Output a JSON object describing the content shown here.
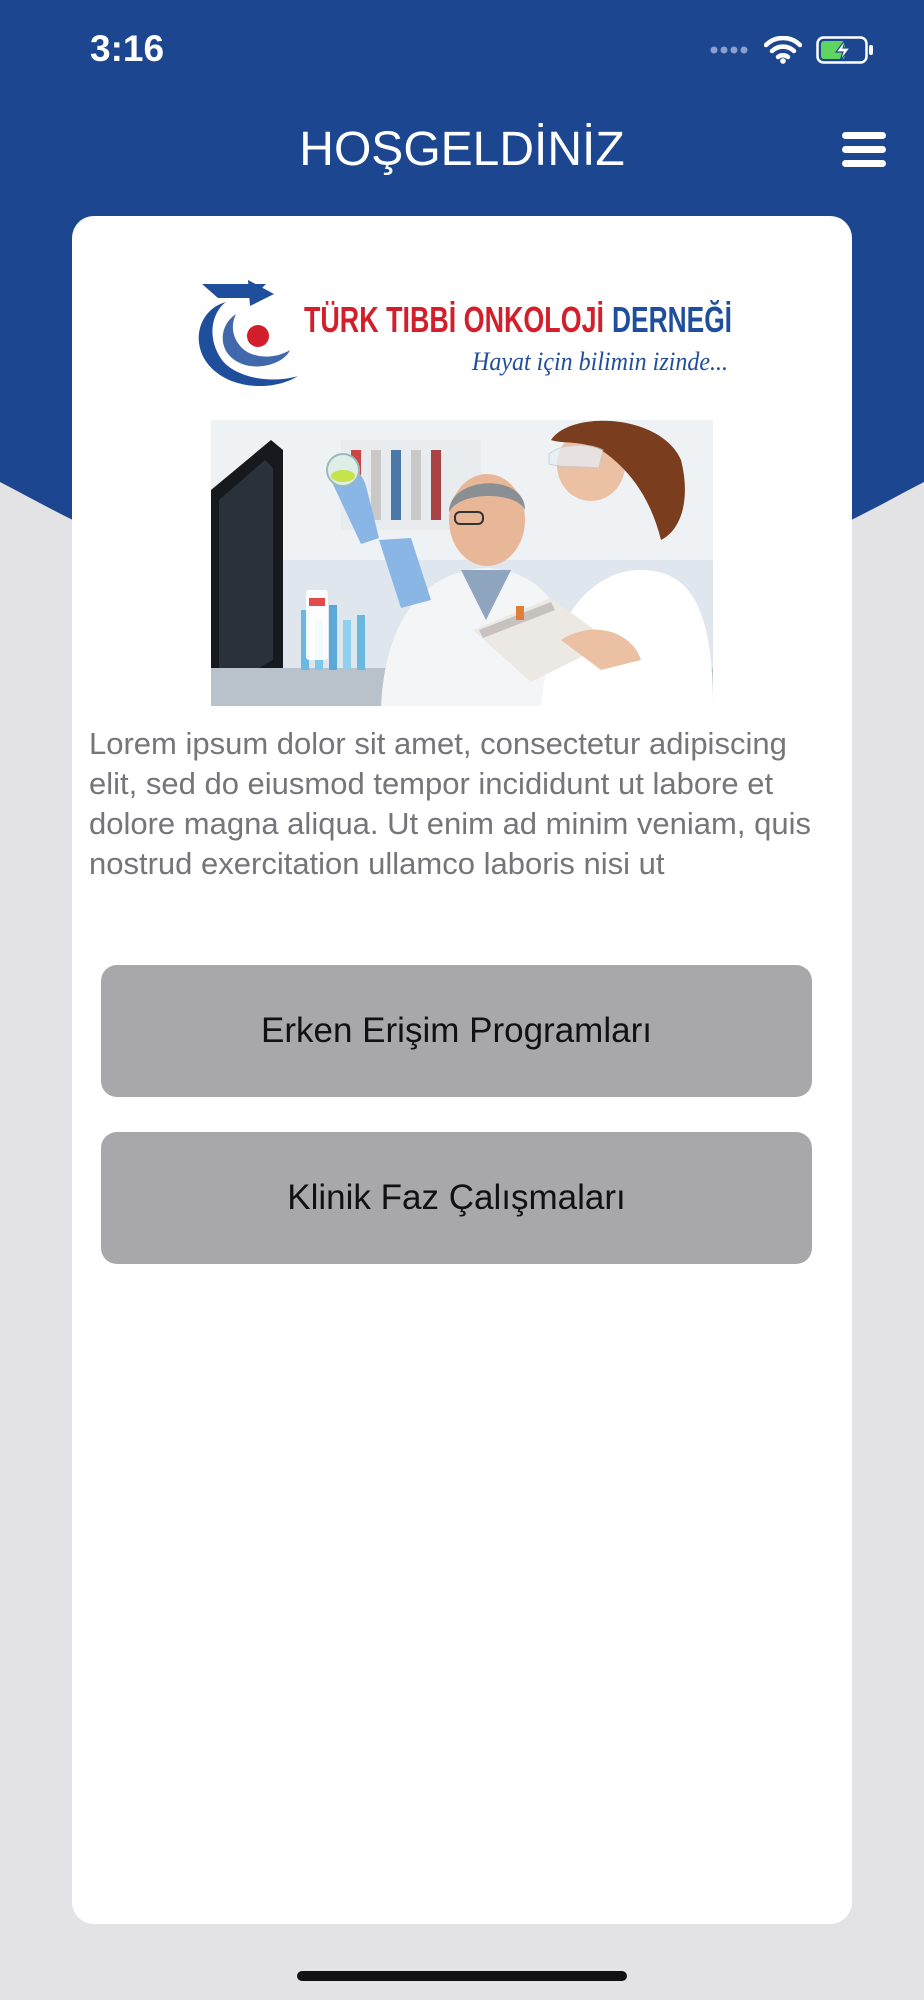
{
  "status_bar": {
    "time": "3:16",
    "icons": [
      "signal-dots-icon",
      "wifi-icon",
      "battery-charging-icon"
    ]
  },
  "header": {
    "title": "HOŞGELDİNİZ",
    "menu_icon": "hamburger-menu-icon"
  },
  "logo": {
    "name": "TÜRK TIBBİ ONKOLOJİ DERNEĞİ",
    "tagline": "Hayat için bilimin izinde..."
  },
  "hero_image": {
    "subject": "laboratory-scientists"
  },
  "content": {
    "intro_text": "Lorem ipsum dolor sit amet, consectetur adipiscing elit, sed do eiusmod tempor incididunt ut labore et dolore magna aliqua. Ut enim ad minim veniam, quis nostrud exercitation ullamco laboris nisi ut"
  },
  "buttons": [
    {
      "label": "Erken Erişim Programları"
    },
    {
      "label": "Klinik Faz Çalışmaları"
    }
  ],
  "colors": {
    "primary_blue": "#1c4690",
    "background": "#e3e3e5",
    "card": "#ffffff",
    "button_gray": "#a8a8aa",
    "logo_red": "#d21f2b",
    "logo_blue": "#1f4e9c"
  }
}
